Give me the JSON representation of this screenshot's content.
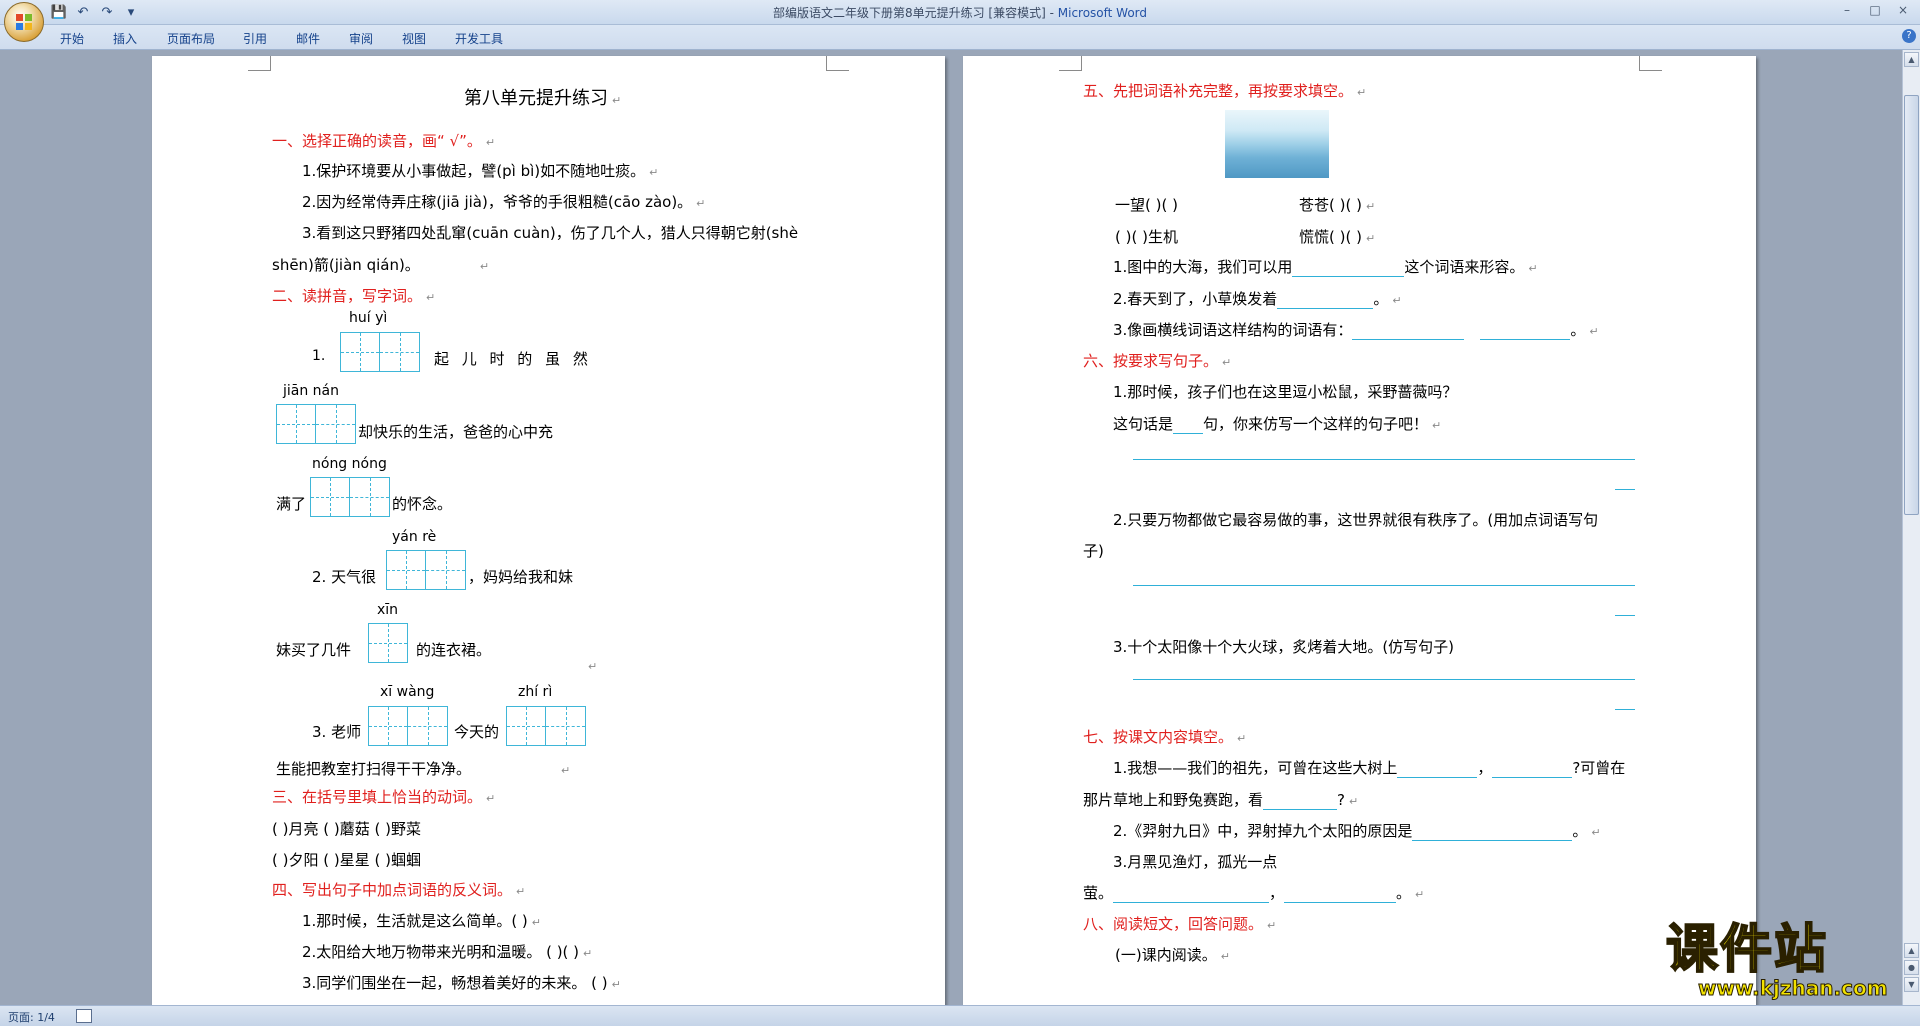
{
  "window": {
    "title": "部编版语文二年级下册第8单元提升练习 [兼容模式] - ",
    "app_name": "Microsoft Word",
    "controls": {
      "minimize": "–",
      "maximize": "□",
      "close": "×"
    }
  },
  "qat": {
    "save_icon": "💾",
    "undo_icon": "↶",
    "redo_icon": "↷",
    "more_icon": "▾"
  },
  "ribbon": {
    "tabs": [
      "开始",
      "插入",
      "页面布局",
      "引用",
      "邮件",
      "审阅",
      "视图",
      "开发工具"
    ],
    "help": "?"
  },
  "page1": {
    "title": "第八单元提升练习",
    "s1_heading": "一、选择正确的读音，画“ √”。",
    "s1_q1": "1.保护环境要从小事做起，譬(pì  bì)如不随地吐痰。",
    "s1_q2": "2.因为经常侍弄庄稼(jiā  jià)，爷爷的手很粗糙(cāo  zào)。",
    "s1_q3a": "3.看到这只野猪四处乱窜(cuān  cuàn)，伤了几个人，猎人只得朝它射(shè",
    "s1_q3b": "shēn)箭(jiàn  qián)。",
    "s2_heading": "二、读拼音，写字词。",
    "s2_py1": "huí   yì",
    "s2_num1": "1.",
    "s2_t1": "起 儿 时 的 虽 然",
    "s2_py2": "jiān  nán",
    "s2_t2": "却快乐的生活，爸爸的心中充",
    "s2_py3": "nóng nóng",
    "s2_t3a": "满了",
    "s2_t3b": "的怀念。",
    "s2_py4": "yán   rè",
    "s2_t4a": "2. 天气很",
    "s2_t4b": "，妈妈给我和妹",
    "s2_py5": "xīn",
    "s2_t5a": "妹买了几件",
    "s2_t5b": "的连衣裙。",
    "s2_py6a": "xī   wàng",
    "s2_py6b": "zhí   rì",
    "s2_t6a": "3. 老师",
    "s2_t6b": "今天的",
    "s2_t7": "生能把教室打扫得干干净净。",
    "s3_heading": "三、在括号里填上恰当的动词。",
    "s3_r1": "(     )月亮  (     )蘑菇  (     )野菜",
    "s3_r2": "(     )夕阳  (     )星星  (     )蝈蝈",
    "s4_heading": "四、写出句子中加点词语的反义词。",
    "s4_q1": "1.那时候，生活就是这么简单。(     )",
    "s4_q2": "2.太阳给大地万物带来光明和温暖。  (     )(     )",
    "s4_q3": "3.同学们围坐在一起，畅想着美好的未来。  (     )"
  },
  "page2": {
    "s5_heading": "五、先把词语补充完整，再按要求填空。",
    "s5_r1a": "一望(     )(     )",
    "s5_r1b": "苍苍(     )(     )",
    "s5_r2a": "(     )(     )生机",
    "s5_r2b": "慌慌(     )(     )",
    "s5_q1a": "1.图中的大海，我们可以用",
    "s5_q1b": "这个词语来形容。",
    "s5_q2a": "2.春天到了，小草焕发着",
    "s5_q2b": "。",
    "s5_q3a": "3.像画横线词语这样结构的词语有：",
    "s5_q3b": "。",
    "s6_heading": "六、按要求写句子。",
    "s6_q1": "1.那时候，孩子们也在这里逗小松鼠，采野蔷薇吗？",
    "s6_q1b_a": "这句话是",
    "s6_q1b_b": "句，你来仿写一个这样的句子吧！",
    "s6_q2a": "2.只要万物都做它最容易做的事，这世界就很有秩序了。(用加点词语写句",
    "s6_q2b": "子)",
    "s6_q3": "3.十个太阳像十个大火球，炙烤着大地。(仿写句子)",
    "s7_heading": "七、按课文内容填空。",
    "s7_q1a": "1.我想——我们的祖先，可曾在这些大树上",
    "s7_q1b": "，",
    "s7_q1c": "?可曾在",
    "s7_q1d": "那片草地上和野兔赛跑，看",
    "s7_q1e": "?",
    "s7_q2a": "2.《羿射九日》中，羿射掉九个太阳的原因是",
    "s7_q2b": "。",
    "s7_q3": "3.月黑见渔灯，孤光一点",
    "s7_q3b": "萤。",
    "s7_q3c": "，",
    "s7_q3d": "。",
    "s8_heading": "八、阅读短文，回答问题。",
    "s8_sub": "(一)课内阅读。"
  },
  "status": {
    "page": "页面: 1/4"
  },
  "watermark": {
    "big": "课件站",
    "url": "www.kjzhan.com"
  },
  "colors": {
    "heading_red": "#e0201e",
    "grid_blue": "#3fb6d8",
    "ribbon_bg": "#cfdcee",
    "workspace": "#9aa6b8"
  }
}
